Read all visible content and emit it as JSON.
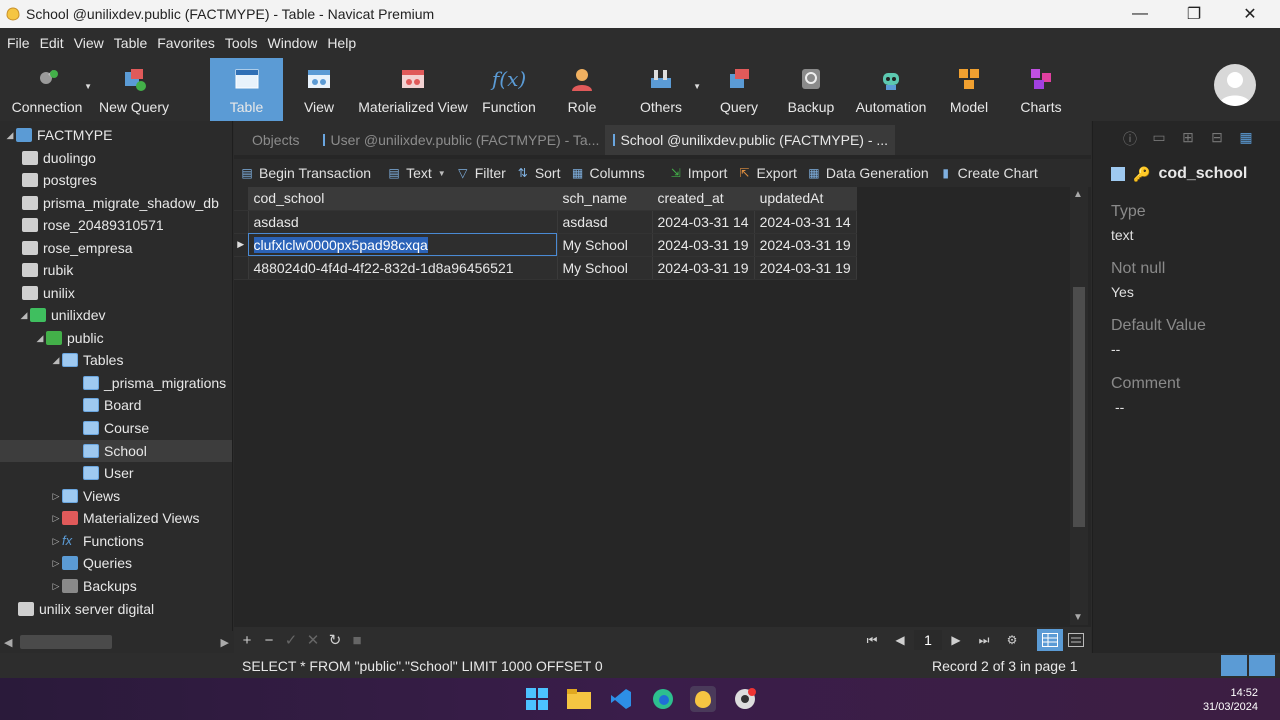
{
  "window": {
    "title": "School @unilixdev.public (FACTMYPE) - Table - Navicat Premium",
    "minimize": "—",
    "maximize": "❐",
    "close": "✕"
  },
  "menu": [
    "File",
    "Edit",
    "View",
    "Table",
    "Favorites",
    "Tools",
    "Window",
    "Help"
  ],
  "toolbar": {
    "connection": "Connection",
    "new_query": "New Query",
    "table": "Table",
    "view": "View",
    "materialized_view": "Materialized View",
    "function": "Function",
    "role": "Role",
    "others": "Others",
    "query": "Query",
    "backup": "Backup",
    "automation": "Automation",
    "model": "Model",
    "charts": "Charts"
  },
  "navigator": {
    "root": "FACTMYPE",
    "databases": [
      "duolingo",
      "postgres",
      "prisma_migrate_shadow_db",
      "rose_20489310571",
      "rose_empresa",
      "rubik",
      "unilix"
    ],
    "active_db": "unilixdev",
    "schema": "public",
    "tables_label": "Tables",
    "tables": [
      "_prisma_migrations",
      "Board",
      "Course",
      "School",
      "User"
    ],
    "selected_table": "School",
    "groups": [
      "Views",
      "Materialized Views",
      "Functions",
      "Queries",
      "Backups"
    ],
    "server": "unilix server digital"
  },
  "tabs": {
    "objects": "Objects",
    "user_tab": "User @unilixdev.public (FACTMYPE) - Ta...",
    "school_tab": "School @unilixdev.public (FACTMYPE) - ..."
  },
  "subtoolbar": {
    "begin_transaction": "Begin Transaction",
    "text": "Text",
    "filter": "Filter",
    "sort": "Sort",
    "columns": "Columns",
    "import": "Import",
    "export": "Export",
    "data_generation": "Data Generation",
    "create_chart": "Create Chart"
  },
  "grid": {
    "columns": [
      "cod_school",
      "sch_name",
      "created_at",
      "updatedAt"
    ],
    "rows": [
      [
        "asdasd",
        "asdasd",
        "2024-03-31 14",
        "2024-03-31 14"
      ],
      [
        "clufxlclw0000px5pad98cxqa",
        "My School",
        "2024-03-31 19",
        "2024-03-31 19"
      ],
      [
        "488024d0-4f4d-4f22-832d-1d8a96456521",
        "My School",
        "2024-03-31 19",
        "2024-03-31 19"
      ]
    ],
    "current_row": 1
  },
  "pager": {
    "page": "1"
  },
  "info": {
    "field_name": "cod_school",
    "type_label": "Type",
    "type_value": "text",
    "notnull_label": "Not null",
    "notnull_value": "Yes",
    "default_label": "Default Value",
    "default_value": "--",
    "comment_label": "Comment",
    "comment_value": "--"
  },
  "status": {
    "sql": "SELECT * FROM \"public\".\"School\" LIMIT 1000 OFFSET 0",
    "record": "Record 2 of 3 in page 1"
  },
  "taskbar": {
    "time": "14:52",
    "date": "31/03/2024"
  },
  "colors": {
    "accent": "#5b9bd5",
    "selection": "#2b63b8",
    "db_active": "#3fbf5f"
  }
}
